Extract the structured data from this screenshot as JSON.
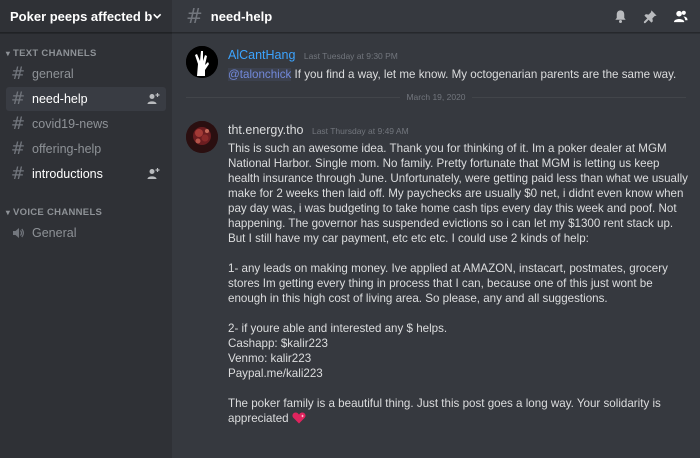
{
  "server": {
    "name": "Poker peeps affected by ..."
  },
  "categories": {
    "text": "TEXT CHANNELS",
    "voice": "VOICE CHANNELS"
  },
  "channels": [
    {
      "name": "general"
    },
    {
      "name": "need-help"
    },
    {
      "name": "covid19-news"
    },
    {
      "name": "offering-help"
    },
    {
      "name": "introductions"
    }
  ],
  "voice_channels": [
    {
      "name": "General"
    }
  ],
  "topbar": {
    "channel_name": "need-help"
  },
  "colors": {
    "link_blue": "#7289da",
    "author1": "#3ca4ff",
    "author2": "#dcddde"
  },
  "messages": [
    {
      "author": "AlCantHang",
      "timestamp": "Last Tuesday at 9:30 PM",
      "mention": "@talonchick",
      "text": " If you find a way, let me know. My octogenarian parents are the same way."
    },
    {
      "author": "tht.energy.tho",
      "timestamp": "Last Thursday at 9:49 AM",
      "paragraphs": [
        "This is such an awesome idea. Thank you for thinking of it. Im a poker dealer at MGM National Harbor. Single mom. No family. Pretty fortunate that MGM is letting us keep health insurance through June. Unfortunately, were getting paid less than what we usually make for 2 weeks then laid off. My paychecks are usually $0 net, i didnt even know when pay day was, i was budgeting to take home cash tips every day this week and poof. Not happening. The governor has suspended evictions so i can let my $1300 rent stack up. But I still have my car payment, etc etc etc. I could use 2 kinds of help:",
        "1- any leads on making money. Ive applied at AMAZON, instacart, postmates, grocery stores Im getting every thing in process that I can, because one of this just wont be enough in this high cost of living area. So please, any and all suggestions.",
        "2- if youre able and interested any $ helps.",
        "Cashapp: $kalir223",
        "Venmo: kalir223",
        "Paypal.me/kali223",
        "The poker family is a beautiful thing. Just this post goes a long way. Your solidarity is appreciated"
      ]
    }
  ],
  "date_divider": "March 19, 2020"
}
